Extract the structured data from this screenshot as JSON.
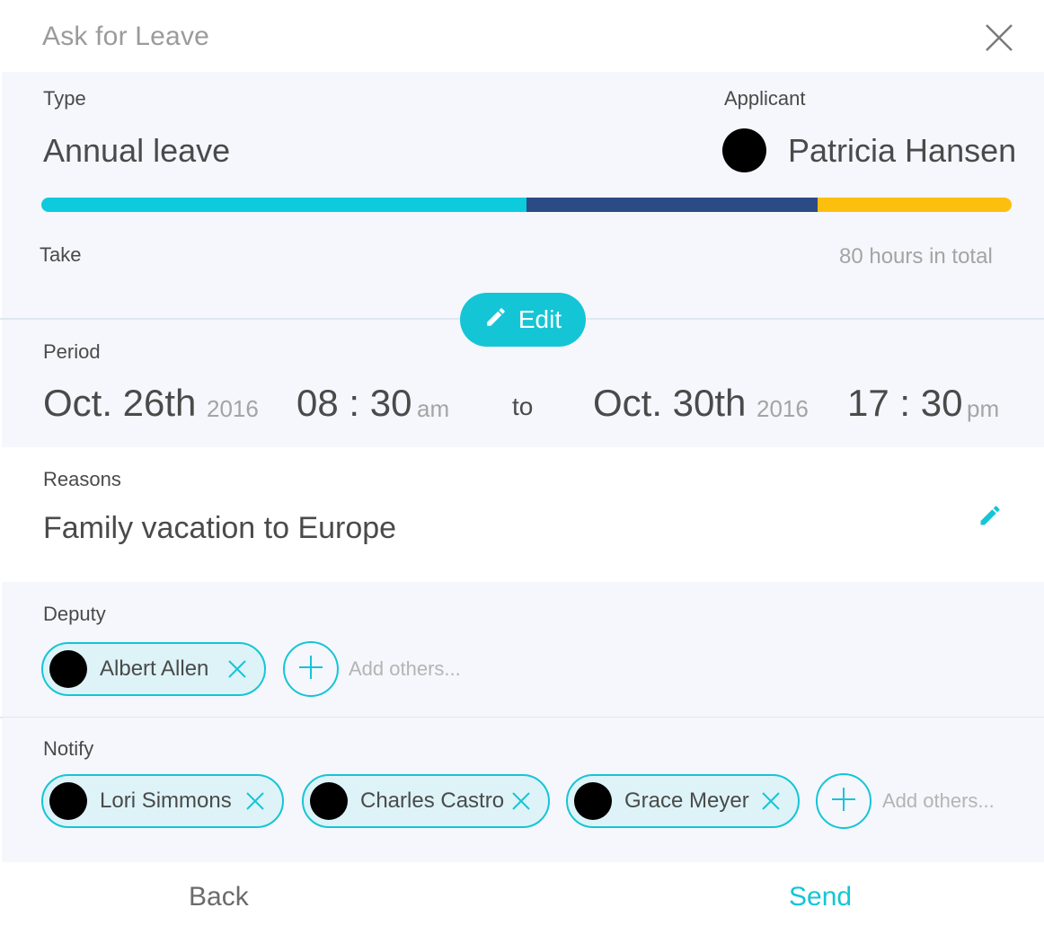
{
  "dialog": {
    "title": "Ask for Leave"
  },
  "type": {
    "label": "Type",
    "value": "Annual leave"
  },
  "applicant": {
    "label": "Applicant",
    "name": "Patricia Hansen"
  },
  "balance_bar": {
    "segments": [
      {
        "fraction": 0.5,
        "color": "#0dcbdc"
      },
      {
        "fraction": 0.3,
        "color": "#2b4b84"
      },
      {
        "fraction": 0.2,
        "color": "#fcbf0d"
      }
    ]
  },
  "take": {
    "label": "Take",
    "total": "80 hours in total",
    "edit_label": "Edit"
  },
  "period": {
    "label": "Period",
    "from": {
      "date": "Oct. 26th",
      "year": "2016",
      "time": "08 : 30",
      "ampm": "am"
    },
    "separator": "to",
    "to": {
      "date": "Oct. 30th",
      "year": "2016",
      "time": "17 : 30",
      "ampm": "pm"
    }
  },
  "reasons": {
    "label": "Reasons",
    "value": "Family vacation to Europe"
  },
  "deputy": {
    "label": "Deputy",
    "people": [
      "Albert Allen"
    ],
    "add_placeholder": "Add others..."
  },
  "notify": {
    "label": "Notify",
    "people": [
      "Lori Simmons",
      "Charles Castro",
      "Grace Meyer"
    ],
    "add_placeholder": "Add others..."
  },
  "footer": {
    "back_label": "Back",
    "send_label": "Send"
  },
  "colors": {
    "accent": "#14c5d6",
    "panel": "#f5f7fc",
    "chip_bg": "#ddf3f8"
  }
}
